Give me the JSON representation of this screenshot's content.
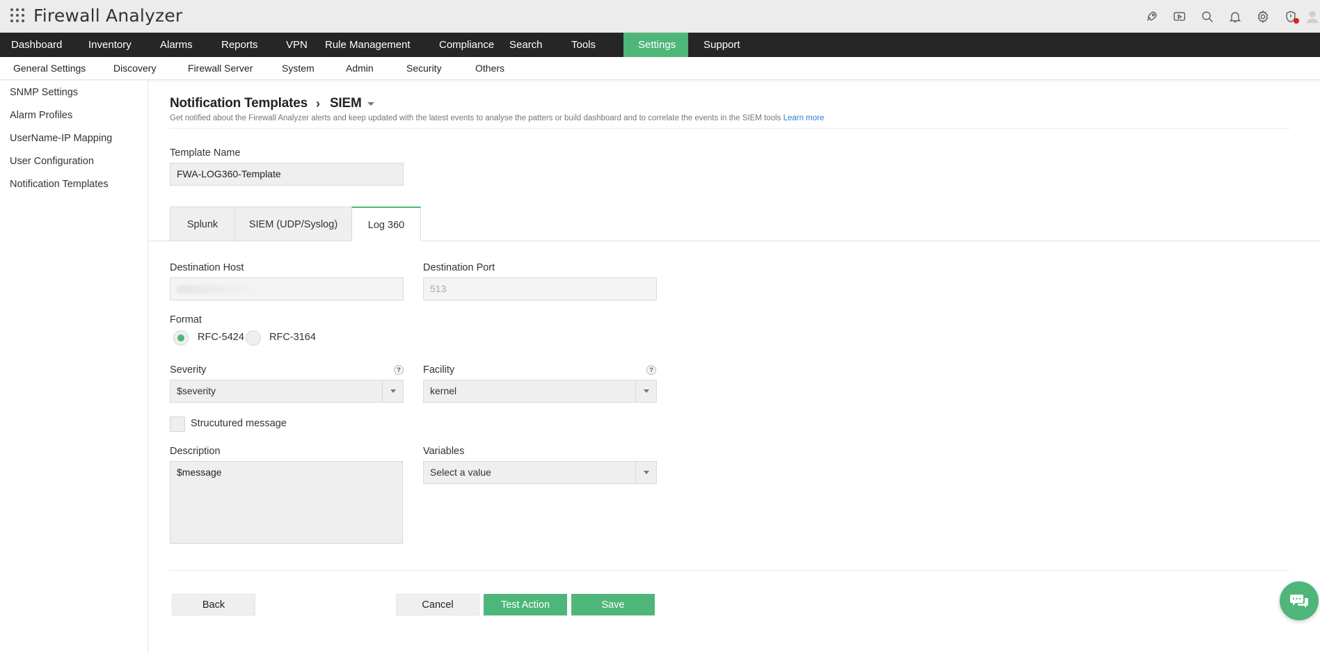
{
  "app": {
    "title": "Firewall Analyzer"
  },
  "top_icons": [
    "rocket-icon",
    "video-icon",
    "search-icon",
    "bell-icon",
    "gear-icon",
    "shield-alert-icon",
    "user-avatar-icon"
  ],
  "main_nav": [
    {
      "label": "Dashboard"
    },
    {
      "label": "Inventory"
    },
    {
      "label": "Alarms"
    },
    {
      "label": "Reports"
    },
    {
      "label": "VPN"
    },
    {
      "label": "Rule Management"
    },
    {
      "label": "Compliance"
    },
    {
      "label": "Search"
    },
    {
      "label": "Tools"
    },
    {
      "label": "Settings",
      "active": true
    },
    {
      "label": "Support"
    }
  ],
  "sub_nav": [
    "General Settings",
    "Discovery",
    "Firewall Server",
    "System",
    "Admin",
    "Security",
    "Others"
  ],
  "sidebar": [
    "SNMP Settings",
    "Alarm Profiles",
    "UserName-IP Mapping",
    "User Configuration",
    "Notification Templates"
  ],
  "header": {
    "title": "Notification Templates",
    "subtitle": "SIEM",
    "description": "Get notified about the Firewall Analyzer alerts and keep updated with the latest events to analyse the patters or build dashboard and to correlate the events in the SIEM tools",
    "learn_more": "Learn more"
  },
  "template_name": {
    "label": "Template Name",
    "value": "FWA-LOG360-Template"
  },
  "tabs": [
    {
      "label": "Splunk"
    },
    {
      "label": "SIEM (UDP/Syslog)"
    },
    {
      "label": "Log 360",
      "active": true
    }
  ],
  "destination": {
    "host_label": "Destination Host",
    "host_value": "",
    "port_label": "Destination Port",
    "port_value": "513"
  },
  "format": {
    "label": "Format",
    "options": [
      "RFC-5424",
      "RFC-3164"
    ],
    "selected": "RFC-5424"
  },
  "severity": {
    "label": "Severity",
    "value": "$severity",
    "help": "?"
  },
  "facility": {
    "label": "Facility",
    "value": "kernel",
    "help": "?"
  },
  "structured": {
    "label": "Strucutured message",
    "checked": false
  },
  "description": {
    "label": "Description",
    "value": "$message"
  },
  "variables": {
    "label": "Variables",
    "placeholder": "Select a value"
  },
  "buttons": {
    "back": "Back",
    "cancel": "Cancel",
    "test": "Test Action",
    "save": "Save"
  },
  "colors": {
    "accent": "#4fb67a",
    "nav_bg": "#262626",
    "link": "#2a7fd4",
    "alert": "#e02020"
  }
}
